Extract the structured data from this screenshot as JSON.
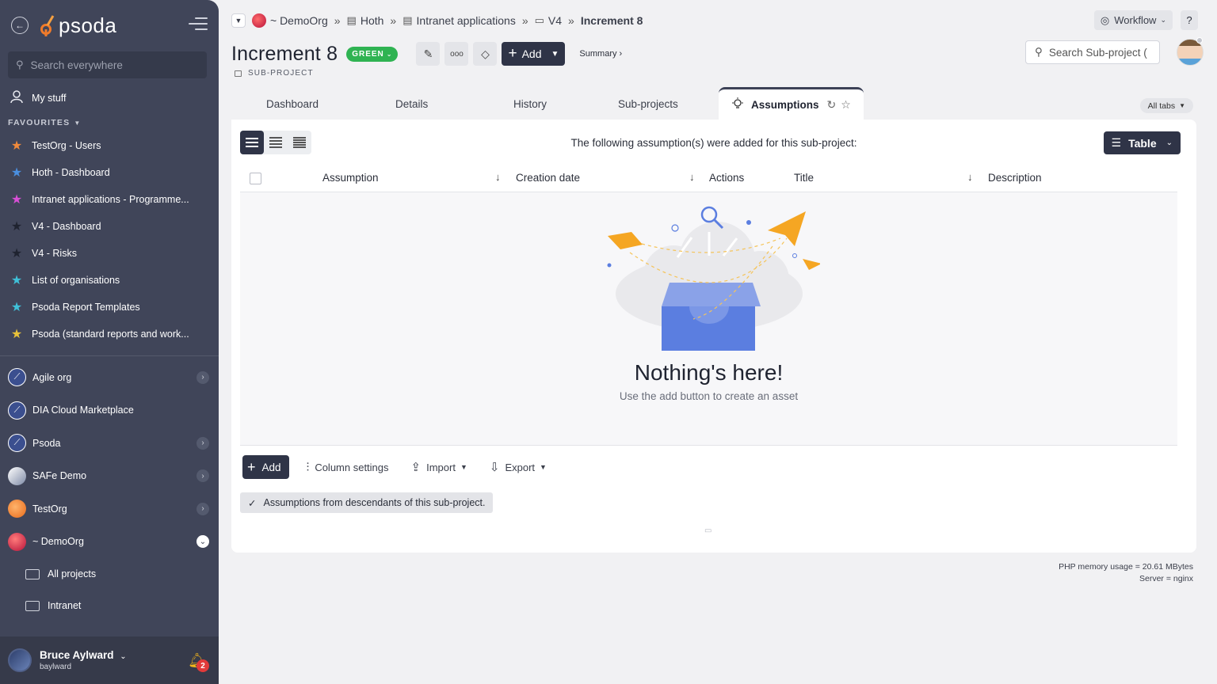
{
  "sidebar": {
    "logo": "psoda",
    "search_placeholder": "Search everywhere",
    "my_stuff": "My stuff",
    "favourites_label": "FAVOURITES",
    "favourites": [
      {
        "label": "TestOrg - Users",
        "color": "#f08a3c"
      },
      {
        "label": "Hoth - Dashboard",
        "color": "#4a8fe0"
      },
      {
        "label": "Intranet applications - Programme...",
        "color": "#d84fd6"
      },
      {
        "label": "V4 - Dashboard",
        "color": "#2b2f3a"
      },
      {
        "label": "V4 - Risks",
        "color": "#2b2f3a"
      },
      {
        "label": "List of organisations",
        "color": "#3fc0d8"
      },
      {
        "label": "Psoda Report Templates",
        "color": "#3fc0d8"
      },
      {
        "label": "Psoda (standard reports and work...",
        "color": "#e8c23a"
      }
    ],
    "orgs": [
      {
        "label": "Agile org",
        "expandable": true
      },
      {
        "label": "DIA Cloud Marketplace",
        "expandable": false
      },
      {
        "label": "Psoda",
        "expandable": true
      },
      {
        "label": "SAFe Demo",
        "expandable": true
      },
      {
        "label": "TestOrg",
        "expandable": true
      },
      {
        "label": "~ DemoOrg",
        "expandable": true
      }
    ],
    "sub_items": [
      "All projects",
      "Intranet"
    ],
    "user": {
      "name": "Bruce Aylward",
      "handle": "baylward",
      "notifications": "2"
    }
  },
  "breadcrumb": {
    "items": [
      "~ DemoOrg",
      "Hoth",
      "Intranet applications",
      "V4"
    ],
    "current": "Increment 8"
  },
  "header": {
    "workflow_label": "Workflow",
    "help_label": "?",
    "title": "Increment 8",
    "status": "GREEN",
    "add_label": "Add",
    "summary_label": "Summary ›",
    "type_label": "SUB-PROJECT",
    "search_placeholder": "Search Sub-project (",
    "more_label": "ooo"
  },
  "tabs": {
    "items": [
      "Dashboard",
      "Details",
      "History",
      "Sub-projects"
    ],
    "active": "Assumptions",
    "all_tabs_label": "All tabs"
  },
  "panel": {
    "heading": "The following assumption(s) were added for this sub-project:",
    "view_label": "Table",
    "columns": [
      "Assumption",
      "Creation date",
      "Actions",
      "Title",
      "Description"
    ],
    "empty_title": "Nothing's here!",
    "empty_subtitle": "Use the add button to create an asset",
    "add_label": "Add",
    "column_settings_label": "Column settings",
    "import_label": "Import",
    "export_label": "Export",
    "descendants_label": "Assumptions from descendants of this sub-project."
  },
  "footer": {
    "memory": "PHP memory usage = 20.61 MBytes",
    "server": "Server = nginx"
  }
}
